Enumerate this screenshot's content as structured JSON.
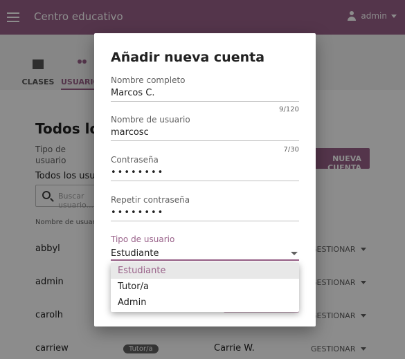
{
  "appbar": {
    "title": "Centro educativo",
    "user": "admin"
  },
  "tabs": [
    {
      "label": "CLASES"
    },
    {
      "label": "USUARIOS"
    }
  ],
  "main": {
    "page_title": "Todos los usuarios",
    "filter_label": "Tipo de usuario",
    "filter_value": "Todos los usuarios",
    "search_placeholder": "Buscar usuario...",
    "new_account_label": "NUEVA CUENTA",
    "column_username": "Nombre de usuario",
    "rows": [
      {
        "username": "abbyl",
        "manage": "GESTIONAR"
      },
      {
        "username": "admin",
        "manage": "GESTIONAR"
      },
      {
        "username": "carolh",
        "manage": "GESTIONAR"
      },
      {
        "username": "carriew",
        "role": "Tutor/a",
        "full_name": "Carrie W.",
        "manage": "GESTIONAR"
      }
    ]
  },
  "dialog": {
    "title": "Añadir nueva cuenta",
    "full_name": {
      "label": "Nombre completo",
      "value": "Marcos C.",
      "counter": "9/120"
    },
    "username": {
      "label": "Nombre de usuario",
      "value": "marcosc",
      "counter": "7/30"
    },
    "password": {
      "label": "Contraseña",
      "value": "••••••••"
    },
    "password_repeat": {
      "label": "Repetir contraseña",
      "value": "••••••••"
    },
    "user_type": {
      "label": "Tipo de usuario",
      "value": "Estudiante"
    }
  },
  "dropdown": {
    "options": [
      "Estudiante",
      "Tutor/a",
      "Admin"
    ],
    "selected": "Estudiante"
  },
  "colors": {
    "brand": "#996189",
    "scrim": "rgba(0,0,0,0.45)"
  }
}
